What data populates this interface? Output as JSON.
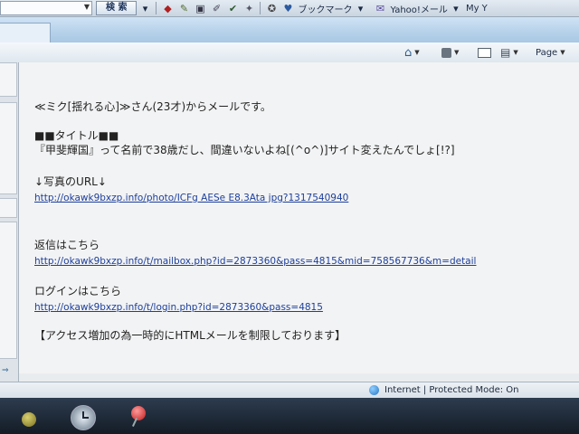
{
  "toolbar": {
    "search_label": "検 索",
    "bookmark_label": "ブックマーク",
    "yahoo_label": "Yahoo!メール",
    "my_label": "My Y",
    "icons": [
      "search-icon",
      "shield-icon",
      "pencil-icon",
      "translate-icon",
      "highlight-icon",
      "check-icon",
      "gear-icon",
      "star-icon"
    ]
  },
  "commandbar": {
    "page_label": "Page"
  },
  "message": {
    "line1": "≪ミク[揺れる心]≫さん(23才)からメールです。",
    "line2": "■■タイトル■■",
    "line3": "『甲斐輝国』って名前で38歳だし、間違いないよね[(^o^)]サイト変えたんでしょ[!?]",
    "line4": "↓写真のURL↓",
    "link1": "http://okawk9bxzp.info/photo/ICFg AESe E8.3Ata jpg?1317540940",
    "line5": "返信はこちら",
    "link2": "http://okawk9bxzp.info/t/mailbox.php?id=2873360&pass=4815&mid=758567736&m=detail",
    "line6": "ログインはこちら",
    "link3": "http://okawk9bxzp.info/t/login.php?id=2873360&pass=4815",
    "line7": "【アクセス増加の為一時的にHTMLメールを制限しております】"
  },
  "status": {
    "zone_text": "Internet | Protected Mode: On"
  }
}
